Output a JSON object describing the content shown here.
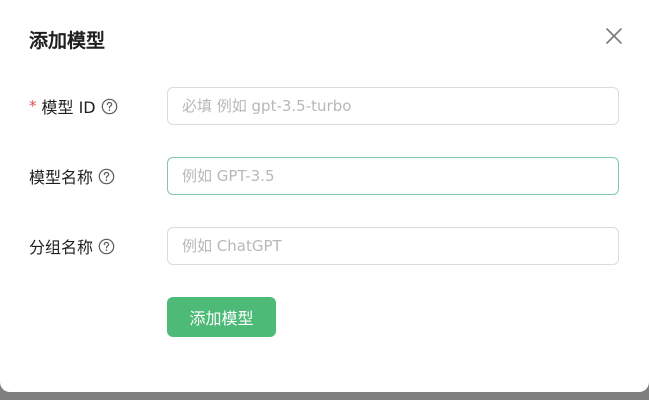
{
  "dialog": {
    "title": "添加模型",
    "close_icon": "close-icon"
  },
  "form": {
    "model_id": {
      "required_mark": "*",
      "label": "模型 ID",
      "help_icon": "question-circle-icon",
      "value": "",
      "placeholder": "必填 例如 gpt-3.5-turbo"
    },
    "model_name": {
      "label": "模型名称",
      "help_icon": "question-circle-icon",
      "value": "",
      "placeholder": "例如 GPT-3.5"
    },
    "group_name": {
      "label": "分组名称",
      "help_icon": "question-circle-icon",
      "value": "",
      "placeholder": "例如 ChatGPT"
    }
  },
  "actions": {
    "submit_label": "添加模型"
  },
  "colors": {
    "primary": "#4dba78",
    "required": "#e04f4f",
    "focus_border": "#7fcaa5"
  }
}
